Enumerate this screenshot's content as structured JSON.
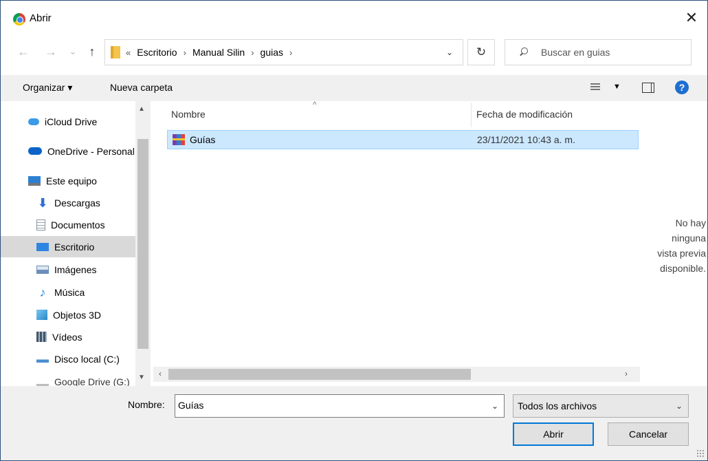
{
  "window": {
    "title": "Abrir",
    "close_glyph": "✕"
  },
  "nav": {
    "back_glyph": "←",
    "forward_glyph": "→",
    "recent_glyph": "⌄",
    "up_glyph": "↑",
    "overflow_glyph": "«",
    "breadcrumbs": [
      "Escritorio",
      "Manual Silin",
      "guias"
    ],
    "sep_glyph": "›",
    "dropdown_glyph": "⌄",
    "refresh_glyph": "↻",
    "search_placeholder": "Buscar en guias"
  },
  "toolbar": {
    "organizar": "Organizar ▾",
    "nueva_carpeta": "Nueva carpeta",
    "view_drop": "▼",
    "help": "?"
  },
  "sidebar": {
    "items": [
      {
        "label": "iCloud Drive",
        "icon": "cloud-icon",
        "color": "#3b9be8"
      },
      {
        "label": "OneDrive - Personal",
        "icon": "onedrive-icon",
        "color": "#0a64c8"
      },
      {
        "label": "Este equipo",
        "icon": "computer-icon",
        "color": "#2d7fd2"
      },
      {
        "label": "Descargas",
        "icon": "download-icon",
        "color": "#2d6fd8"
      },
      {
        "label": "Documentos",
        "icon": "documents-icon",
        "color": "#9aa4ae"
      },
      {
        "label": "Escritorio",
        "icon": "desktop-icon",
        "color": "#2f86e0",
        "selected": true
      },
      {
        "label": "Imágenes",
        "icon": "pictures-icon",
        "color": "#6b8fb8"
      },
      {
        "label": "Música",
        "icon": "music-icon",
        "color": "#2f86e0"
      },
      {
        "label": "Objetos 3D",
        "icon": "objects-3d-icon",
        "color": "#3aa0d8"
      },
      {
        "label": "Vídeos",
        "icon": "videos-icon",
        "color": "#445566"
      },
      {
        "label": "Disco local (C:)",
        "icon": "disk-icon",
        "color": "#4a8fd0"
      },
      {
        "label": "Google Drive (G:)",
        "icon": "google-drive-icon",
        "color": "#999999"
      }
    ],
    "scroll_up": "▲",
    "scroll_down": "▼"
  },
  "filelist": {
    "columns": {
      "name": "Nombre",
      "date": "Fecha de modificación"
    },
    "sort_glyph": "^",
    "rows": [
      {
        "name": "Guías",
        "date": "23/11/2021 10:43 a. m."
      }
    ],
    "hscroll_left": "‹",
    "hscroll_right": "›"
  },
  "preview": {
    "message_lines": [
      "No hay",
      "ninguna",
      "vista previa",
      "disponible."
    ]
  },
  "footer": {
    "name_label": "Nombre:",
    "name_value": "Guías",
    "dropdown_glyph": "⌄",
    "file_type": "Todos los archivos",
    "open_button": "Abrir",
    "cancel_button": "Cancelar"
  }
}
